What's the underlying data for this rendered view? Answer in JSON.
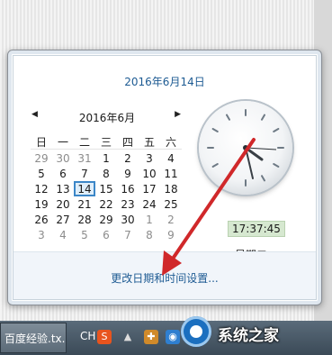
{
  "flyout": {
    "date_header": "2016年6月14日",
    "calendar": {
      "month_title": "2016年6月",
      "prev_symbol": "◀",
      "next_symbol": "▶",
      "weekdays": [
        "日",
        "一",
        "二",
        "三",
        "四",
        "五",
        "六"
      ],
      "weeks": [
        [
          "29",
          "30",
          "31",
          "1",
          "2",
          "3",
          "4"
        ],
        [
          "5",
          "6",
          "7",
          "8",
          "9",
          "10",
          "11"
        ],
        [
          "12",
          "13",
          "14",
          "15",
          "16",
          "17",
          "18"
        ],
        [
          "19",
          "20",
          "21",
          "22",
          "23",
          "24",
          "25"
        ],
        [
          "26",
          "27",
          "28",
          "29",
          "30",
          "1",
          "2"
        ],
        [
          "3",
          "4",
          "5",
          "6",
          "7",
          "8",
          "9"
        ]
      ],
      "selected_day": "14"
    },
    "clock": {
      "time": "17:37:45",
      "weekday": "星期二"
    },
    "footer_link": "更改日期和时间设置..."
  },
  "taskbar": {
    "task_button_label": "百度经验.tx...",
    "language": "CH",
    "tray_icons": [
      "sogou-ime-icon",
      "arrow-up-icon",
      "security-shield-icon",
      "network-icon"
    ]
  },
  "watermark": {
    "text": "系统之家"
  },
  "colors": {
    "link": "#1e5b93",
    "accent": "#3c87c8",
    "arrow": "#d0282a",
    "time_bg": "#d6e8d0"
  }
}
